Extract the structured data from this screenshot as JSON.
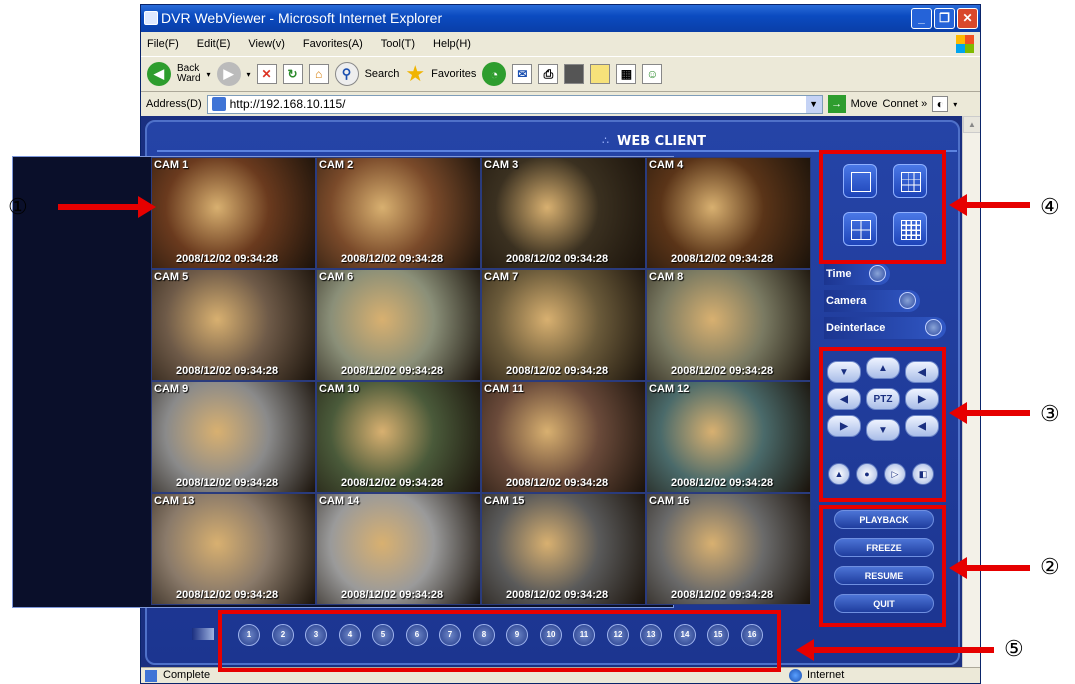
{
  "window": {
    "title": "DVR WebViewer - Microsoft Internet Explorer"
  },
  "menu": [
    "File(F)",
    "Edit(E)",
    "View(v)",
    "Favorites(A)",
    "Tool(T)",
    "Help(H)"
  ],
  "toolbar": {
    "back": "Back",
    "back2": "Ward",
    "search": "Search",
    "favorites": "Favorites"
  },
  "address": {
    "label": "Address(D)",
    "url": "http://192.168.10.115/",
    "move": "Move",
    "connect": "Connet"
  },
  "app": {
    "title": "WEB CLIENT"
  },
  "cameras": [
    {
      "label": "CAM 1",
      "ts": "2008/12/02  09:34:28",
      "color": "#6a3a1e"
    },
    {
      "label": "CAM 2",
      "ts": "2008/12/02  09:34:28",
      "color": "#7a4a2a"
    },
    {
      "label": "CAM 3",
      "ts": "2008/12/02  09:34:28",
      "color": "#3a3020"
    },
    {
      "label": "CAM 4",
      "ts": "2008/12/02  09:34:28",
      "color": "#5a3418"
    },
    {
      "label": "CAM 5",
      "ts": "2008/12/02  09:34:28",
      "color": "#6e5a48"
    },
    {
      "label": "CAM 6",
      "ts": "2008/12/02  09:34:28",
      "color": "#8a8f78"
    },
    {
      "label": "CAM 7",
      "ts": "2008/12/02  09:34:28",
      "color": "#6a5a3a"
    },
    {
      "label": "CAM 8",
      "ts": "2008/12/02  09:34:28",
      "color": "#7a7a62"
    },
    {
      "label": "CAM 9",
      "ts": "2008/12/02  09:34:28",
      "color": "#8a8a8a"
    },
    {
      "label": "CAM 10",
      "ts": "2008/12/02  09:34:28",
      "color": "#4a5a3a"
    },
    {
      "label": "CAM 11",
      "ts": "2008/12/02  09:34:28",
      "color": "#6a4a3a"
    },
    {
      "label": "CAM 12",
      "ts": "2008/12/02  09:34:28",
      "color": "#4a6a6a"
    },
    {
      "label": "CAM 13",
      "ts": "2008/12/02  09:34:28",
      "color": "#8a7a6a"
    },
    {
      "label": "CAM 14",
      "ts": "2008/12/02  09:34:28",
      "color": "#9a9a9a"
    },
    {
      "label": "CAM 15",
      "ts": "2008/12/02  09:34:28",
      "color": "#5a5a5a"
    },
    {
      "label": "CAM 16",
      "ts": "2008/12/02  09:34:28",
      "color": "#6a6a6a"
    }
  ],
  "options": {
    "time": "Time",
    "camera": "Camera",
    "deinterlace": "Deinterlace"
  },
  "ptz": {
    "center": "PTZ"
  },
  "actions": {
    "playback": "PLAYBACK",
    "freeze": "FREEZE",
    "resume": "RESUME",
    "quit": "QUIT"
  },
  "channels": [
    "1",
    "2",
    "3",
    "4",
    "5",
    "6",
    "7",
    "8",
    "9",
    "10",
    "11",
    "12",
    "13",
    "14",
    "15",
    "16"
  ],
  "status": {
    "left": "Complete",
    "zone": "Internet"
  },
  "callouts": {
    "c1": "①",
    "c2": "②",
    "c3": "③",
    "c4": "④",
    "c5": "⑤"
  }
}
